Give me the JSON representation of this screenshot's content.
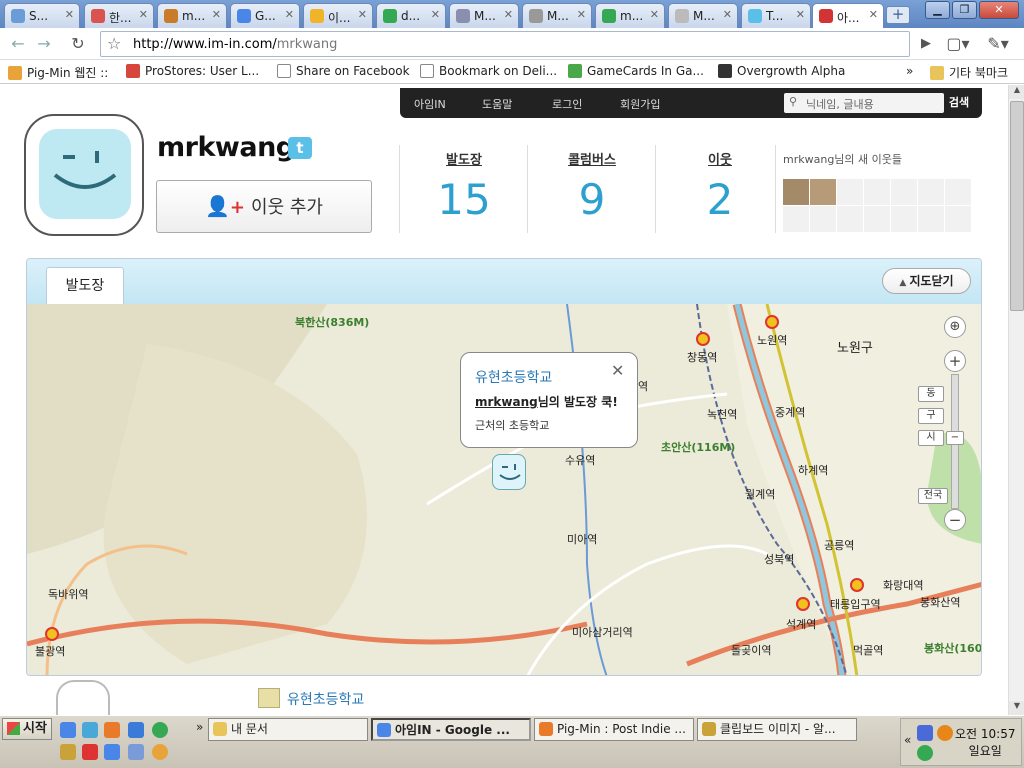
{
  "browser": {
    "tabs": [
      {
        "label": "S...",
        "color": "#6a9cd8"
      },
      {
        "label": "한...",
        "color": "#d9534f"
      },
      {
        "label": "m...",
        "color": "#c97b2a"
      },
      {
        "label": "G...",
        "color": "#4a86e8"
      },
      {
        "label": "이...",
        "color": "#f0b429"
      },
      {
        "label": "d...",
        "color": "#34a853"
      },
      {
        "label": "M...",
        "color": "#8a8fb0"
      },
      {
        "label": "M...",
        "color": "#999999"
      },
      {
        "label": "m...",
        "color": "#34a853"
      },
      {
        "label": "M...",
        "color": "#bbbbbb"
      },
      {
        "label": "T...",
        "color": "#5bc0e8"
      },
      {
        "label": "아...",
        "color": "#d33333"
      }
    ],
    "new_tab_label": "+",
    "url_host": "http://www.im-in.com/",
    "url_path": "mrkwang",
    "bookmarks": [
      {
        "label": "Pig-Min 웹진 ::",
        "color": "#e8a33a"
      },
      {
        "label": "ProStores: User L...",
        "color": "#d6463c"
      },
      {
        "label": "Share on Facebook",
        "color": "#dddddd"
      },
      {
        "label": "Bookmark on Deli...",
        "color": "#dddddd"
      },
      {
        "label": "GameCards In Ga...",
        "color": "#4aa84a"
      },
      {
        "label": "Overgrowth Alpha",
        "color": "#333333"
      },
      {
        "label": "»",
        "color": ""
      },
      {
        "label": "기타 북마크",
        "color": "#e8c45a"
      }
    ]
  },
  "site_nav": {
    "items": [
      "아임IN",
      "도움말",
      "로그인",
      "회원가입"
    ],
    "search_placeholder": "닉네임, 글내용",
    "search_button": "검색"
  },
  "profile": {
    "username": "mrkwang",
    "twitter_badge": "t",
    "add_neighbor_label": "이웃 추가",
    "stats": [
      {
        "label": "발도장",
        "value": "15"
      },
      {
        "label": "콜럼버스",
        "value": "9"
      },
      {
        "label": "이웃",
        "value": "2"
      }
    ],
    "new_neighbors_title": "mrkwang님의 새 이웃들"
  },
  "map_section": {
    "tab_label": "발도장",
    "close_button": "지도닫기",
    "popup": {
      "title": "유현초등학교",
      "line_user": "mrkwang",
      "line_rest": "님의 발도장 쿡!",
      "subtitle": "근처의 초등학교"
    },
    "labels": {
      "mountain1": "북한산(836M)",
      "mountain2": "초안산(116M)",
      "mountain3": "봉화산(160",
      "station_nowon": "노원역",
      "station_nowon_gu": "노원구",
      "station_changdong": "창동역",
      "station_nokcheon": "녹천역",
      "station_junggye": "중계역",
      "station_hagye": "하계역",
      "station_wolgye": "월계역",
      "station_suyu": "수유역",
      "station_mia": "미아역",
      "station_seonggye": "성북역",
      "station_gongneung": "공릉역",
      "station_hwarangdae": "화랑대역",
      "station_bonghwasan": "봉화산역",
      "station_taereung": "태릉입구역",
      "station_seokgye": "석계역",
      "station_miasamgeori": "미아삼거리역",
      "station_dongbawi": "독바위역",
      "station_bulgwang": "불광역",
      "station_dolgoji": "돌곶이역",
      "station_meokgol": "먹골역",
      "partial_yeok": "역"
    },
    "map_controls": {
      "zoom_in": "+",
      "zoom_out": "−",
      "level_dong": "동",
      "level_gu": "구",
      "level_si": "시",
      "level_all": "전국"
    }
  },
  "listing": {
    "place_title": "유현초등학교"
  },
  "taskbar": {
    "start_label": "시작",
    "buttons": [
      {
        "label": "내 문서",
        "color": "#e8c45a"
      },
      {
        "label": "아임IN - Google ...",
        "color": "#4a86e8"
      },
      {
        "label": "Pig-Min : Post Indie ...",
        "color": "#e87a2a"
      },
      {
        "label": "클립보드 이미지 - 알...",
        "color": "#c9a23a"
      }
    ],
    "clock_time": "오전 10:57",
    "clock_day": "일요일"
  }
}
